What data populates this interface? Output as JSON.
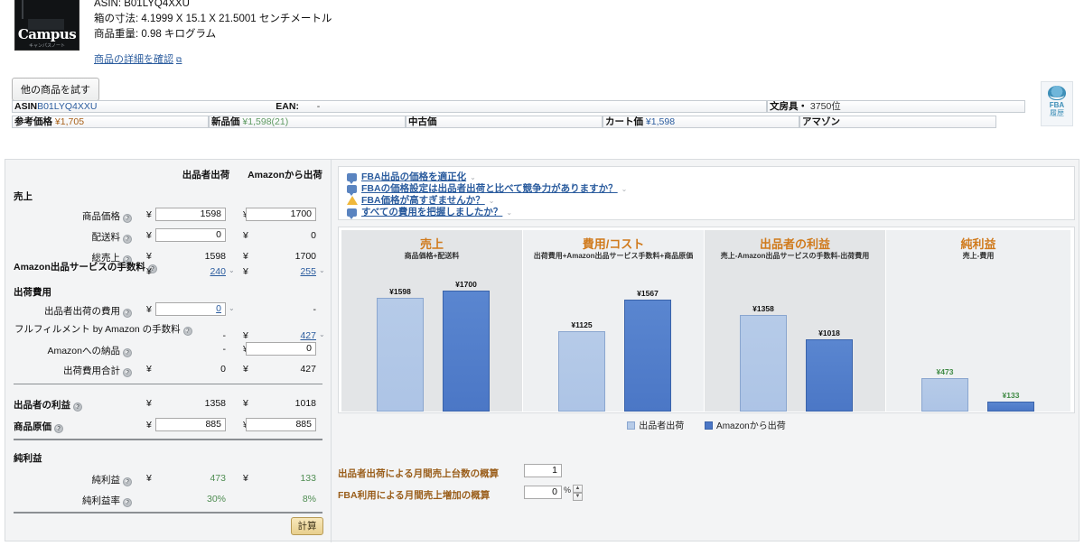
{
  "product": {
    "thumb_brand": "Campus",
    "thumb_sub": "キャンパスノート",
    "asin_line": "ASIN: B01LYQ4XXU",
    "dimensions_line": "箱の寸法: 4.1999 X 15.1 X 21.5001 センチメートル",
    "weight_line": "商品重量: 0.98 キログラム",
    "detail_link": "商品の詳細を確認",
    "detail_link_icon": "external-link-icon",
    "try_other_button": "他の商品を試す"
  },
  "info_bar": {
    "asin_label": "ASIN",
    "asin_value": "B01LYQ4XXU",
    "ean_label": "EAN:",
    "ean_value": "-",
    "category_label": "文房具・",
    "category_rank": "3750位"
  },
  "price_bar": {
    "list_label": "参考価格",
    "list_value": "¥1,705",
    "new_label": "新品価",
    "new_value": "¥1,598(21)",
    "used_label": "中古価",
    "used_value": "",
    "cart_label": "カート価",
    "cart_value": "¥1,598",
    "seller_label": "アマゾン",
    "seller_value": ""
  },
  "fba_badge": {
    "icon": "fba-globe-icon",
    "line1": "FBA",
    "line2": "履歴"
  },
  "calculator": {
    "column_headers": {
      "merchant": "出品者出荷",
      "amazon": "Amazonから出荷"
    },
    "sections": {
      "revenue": "売上",
      "shipping_costs": "出荷費用",
      "net_profit": "純利益"
    },
    "rows": [
      {
        "label": "商品価格",
        "type": "input",
        "merchant": "1598",
        "amazon": "1700"
      },
      {
        "label": "配送料",
        "type": "input",
        "merchant": "0",
        "amazon": "0"
      },
      {
        "label": "総売上",
        "type": "read",
        "merchant": "1598",
        "amazon": "1700"
      },
      {
        "label": "Amazon出品サービスの手数料",
        "type": "link",
        "merchant": "240",
        "amazon": "255"
      },
      {
        "label": "出品者出荷の費用",
        "type": "input-link",
        "merchant": "0",
        "amazon": "-"
      },
      {
        "label": "フルフィルメント by Amazon の手数料",
        "type": "link-right",
        "merchant": "-",
        "amazon": "427"
      },
      {
        "label": "Amazonへの納品",
        "type": "input-right",
        "merchant": "-",
        "amazon": "0"
      },
      {
        "label": "出荷費用合計",
        "type": "read",
        "merchant": "0",
        "amazon": "427"
      },
      {
        "label": "出品者の利益",
        "type": "read",
        "merchant": "1358",
        "amazon": "1018"
      },
      {
        "label": "商品原価",
        "type": "input",
        "merchant": "885",
        "amazon": "885"
      },
      {
        "label": "純利益",
        "type": "read-green",
        "merchant": "473",
        "amazon": "133"
      },
      {
        "label": "純利益率",
        "type": "read-green-pct",
        "merchant": "30%",
        "amazon": "8%"
      }
    ],
    "yen_symbol": "¥",
    "help_icon": "help-icon",
    "chevron_icon": "chevron-down-icon",
    "calculate_button": "計算"
  },
  "tips": [
    {
      "icon": "speech-bubble-icon",
      "text": "FBA出品の価格を適正化",
      "dropdown_icon": "chevron-down-icon"
    },
    {
      "icon": "speech-bubble-icon",
      "text": "FBAの価格設定は出品者出荷と比べて競争力がありますか？",
      "dropdown_icon": "chevron-down-icon"
    },
    {
      "icon": "warning-icon",
      "text": "FBA価格が高すぎませんか？",
      "dropdown_icon": "chevron-down-icon"
    },
    {
      "icon": "speech-bubble-icon",
      "text": "すべての費用を把握しましたか？",
      "dropdown_icon": "chevron-down-icon"
    }
  ],
  "legend": [
    {
      "name": "出品者出荷",
      "color": "#b6cbe8"
    },
    {
      "name": "Amazonから出荷",
      "color": "#4b77c6"
    }
  ],
  "estimates": [
    {
      "label": "出品者出荷による月間売上台数の概算",
      "value": "1",
      "suffix": ""
    },
    {
      "label": "FBA利用による月間売上増加の概算",
      "value": "0",
      "suffix": "%"
    }
  ],
  "chart_data": {
    "type": "bar",
    "title": "",
    "xlabel": "",
    "ylabel": "",
    "grid": false,
    "legend_position": "bottom",
    "categories": [
      "出品者出荷",
      "Amazonから出荷"
    ],
    "ylim": [
      0,
      1700
    ],
    "panels": [
      {
        "title": "売上",
        "subtitle": "商品価格+配送料",
        "values": [
          1598,
          1700
        ],
        "labels": [
          "¥1598",
          "¥1700"
        ],
        "label_color": "#111111",
        "background": "#e3e5e7"
      },
      {
        "title": "費用/コスト",
        "subtitle": "出荷費用+Amazon出品サービス手数料+商品原価",
        "values": [
          1125,
          1567
        ],
        "labels": [
          "¥1125",
          "¥1567"
        ],
        "label_color": "#111111",
        "background": "#eef0f2"
      },
      {
        "title": "出品者の利益",
        "subtitle": "売上-Amazon出品サービスの手数料-出荷費用",
        "values": [
          1358,
          1018
        ],
        "labels": [
          "¥1358",
          "¥1018"
        ],
        "label_color": "#111111",
        "background": "#e3e5e7"
      },
      {
        "title": "純利益",
        "subtitle": "売上-費用",
        "values": [
          473,
          133
        ],
        "labels": [
          "¥473",
          "¥133"
        ],
        "label_color": "#3f8a44",
        "background": "#eef0f2"
      }
    ],
    "series": [
      {
        "name": "出品者出荷",
        "color": "#b6cbe8",
        "values": [
          1598,
          1125,
          1358,
          473
        ]
      },
      {
        "name": "Amazonから出荷",
        "color": "#4b77c6",
        "values": [
          1700,
          1567,
          1018,
          133
        ]
      }
    ]
  }
}
